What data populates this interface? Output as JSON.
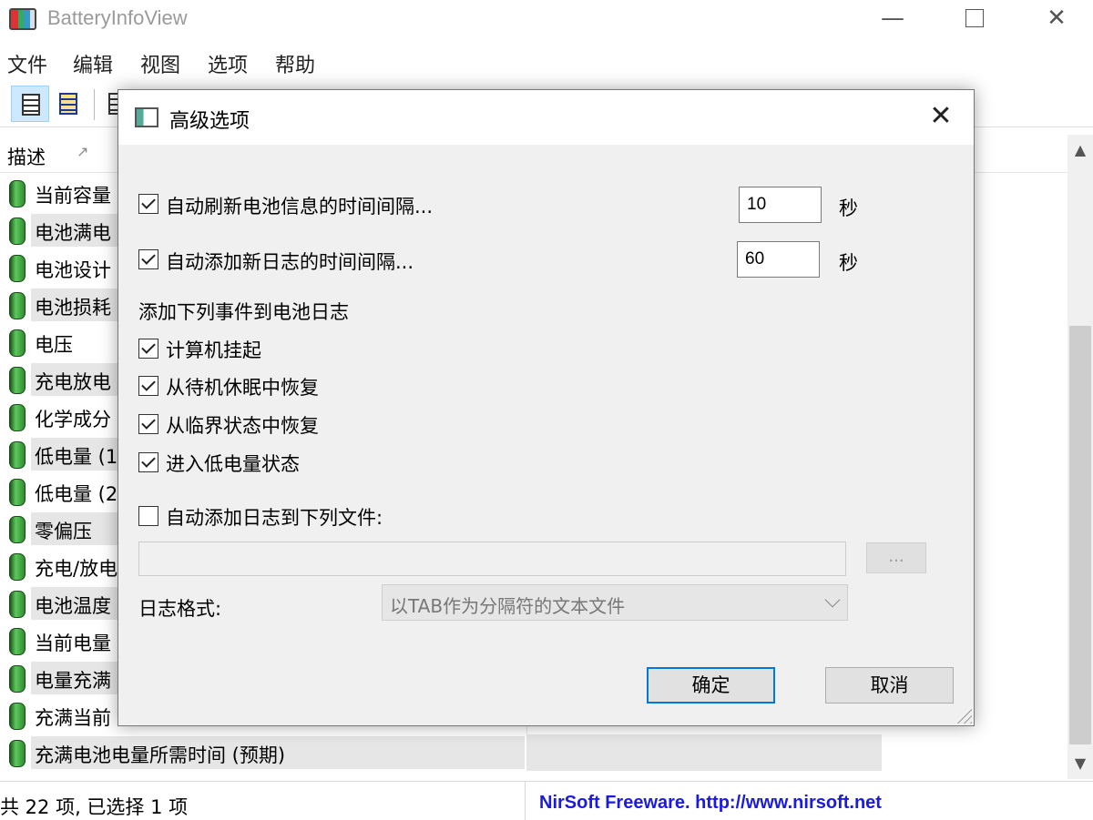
{
  "window": {
    "title": "BatteryInfoView",
    "min_glyph": "—",
    "close_glyph": "✕"
  },
  "menu": [
    "文件",
    "编辑",
    "视图",
    "选项",
    "帮助"
  ],
  "list": {
    "column_description": "描述",
    "rows": [
      "当前容量",
      "电池满电",
      "电池设计",
      "电池损耗",
      "电压",
      "充电放电",
      "化学成分",
      "低电量 (1",
      "低电量 (2",
      "零偏压",
      "充电/放电",
      "电池温度",
      "当前电量",
      "电量充满",
      "充满当前",
      "充满电池电量所需时间 (预期)"
    ]
  },
  "status": {
    "left": "共 22 项, 已选择 1 项",
    "right": "NirSoft Freeware.  http://www.nirsoft.net"
  },
  "dialog": {
    "title": "高级选项",
    "close_glyph": "✕",
    "refresh": {
      "label": "自动刷新电池信息的时间间隔...",
      "checked": true,
      "value": "10",
      "unit": "秒"
    },
    "add_log": {
      "label": "自动添加新日志的时间间隔...",
      "checked": true,
      "value": "60",
      "unit": "秒"
    },
    "events_heading": "添加下列事件到电池日志",
    "events": [
      {
        "label": "计算机挂起",
        "checked": true
      },
      {
        "label": "从待机休眠中恢复",
        "checked": true
      },
      {
        "label": "从临界状态中恢复",
        "checked": true
      },
      {
        "label": "进入低电量状态",
        "checked": true
      }
    ],
    "log_to_file": {
      "label": "自动添加日志到下列文件:",
      "checked": false
    },
    "browse_label": "...",
    "format_label": "日志格式:",
    "format_value": "以TAB作为分隔符的文本文件",
    "ok": "确定",
    "cancel": "取消"
  }
}
